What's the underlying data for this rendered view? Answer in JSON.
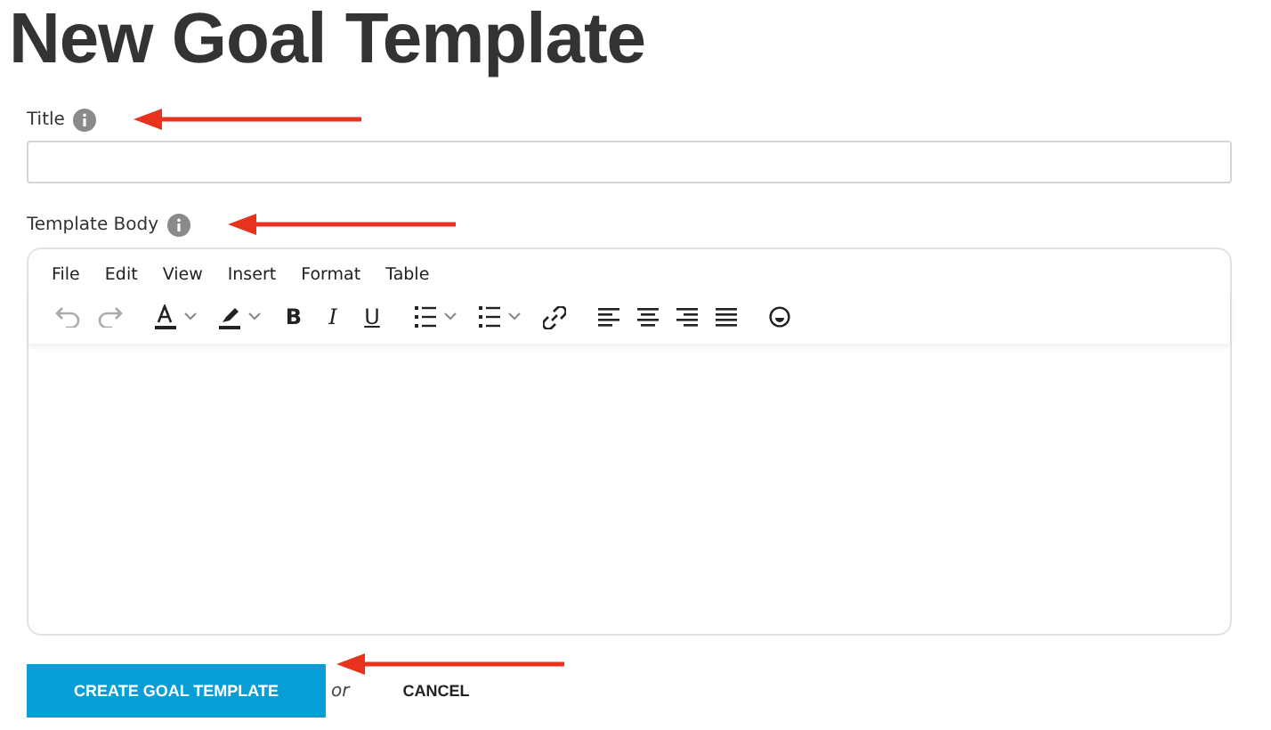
{
  "heading": "New Goal Template",
  "title_field": {
    "label": "Title"
  },
  "body_field": {
    "label": "Template Body"
  },
  "editor": {
    "menu": [
      "File",
      "Edit",
      "View",
      "Insert",
      "Format",
      "Table"
    ],
    "toolbar": [
      [
        {
          "kind": "undo",
          "disabled": true
        },
        {
          "kind": "redo",
          "disabled": true
        }
      ],
      [
        {
          "kind": "text-color",
          "disabled": false
        },
        {
          "kind": "highlight",
          "disabled": false
        },
        {
          "kind": "bold",
          "glyph": "B",
          "disabled": false
        },
        {
          "kind": "italic",
          "glyph": "I",
          "disabled": false
        },
        {
          "kind": "underline",
          "glyph": "U",
          "disabled": false
        }
      ],
      [
        {
          "kind": "bullet-list",
          "disabled": false
        },
        {
          "kind": "numbered-list",
          "disabled": false
        },
        {
          "kind": "link",
          "disabled": false
        }
      ],
      [
        {
          "kind": "align-left",
          "disabled": false
        },
        {
          "kind": "align-center",
          "disabled": false
        },
        {
          "kind": "align-right",
          "disabled": false
        },
        {
          "kind": "justify",
          "disabled": false
        }
      ],
      [
        {
          "kind": "emoji",
          "disabled": false
        }
      ]
    ]
  },
  "actions": {
    "submit": "CREATE GOAL TEMPLATE",
    "separator": "or",
    "cancel": "CANCEL"
  }
}
